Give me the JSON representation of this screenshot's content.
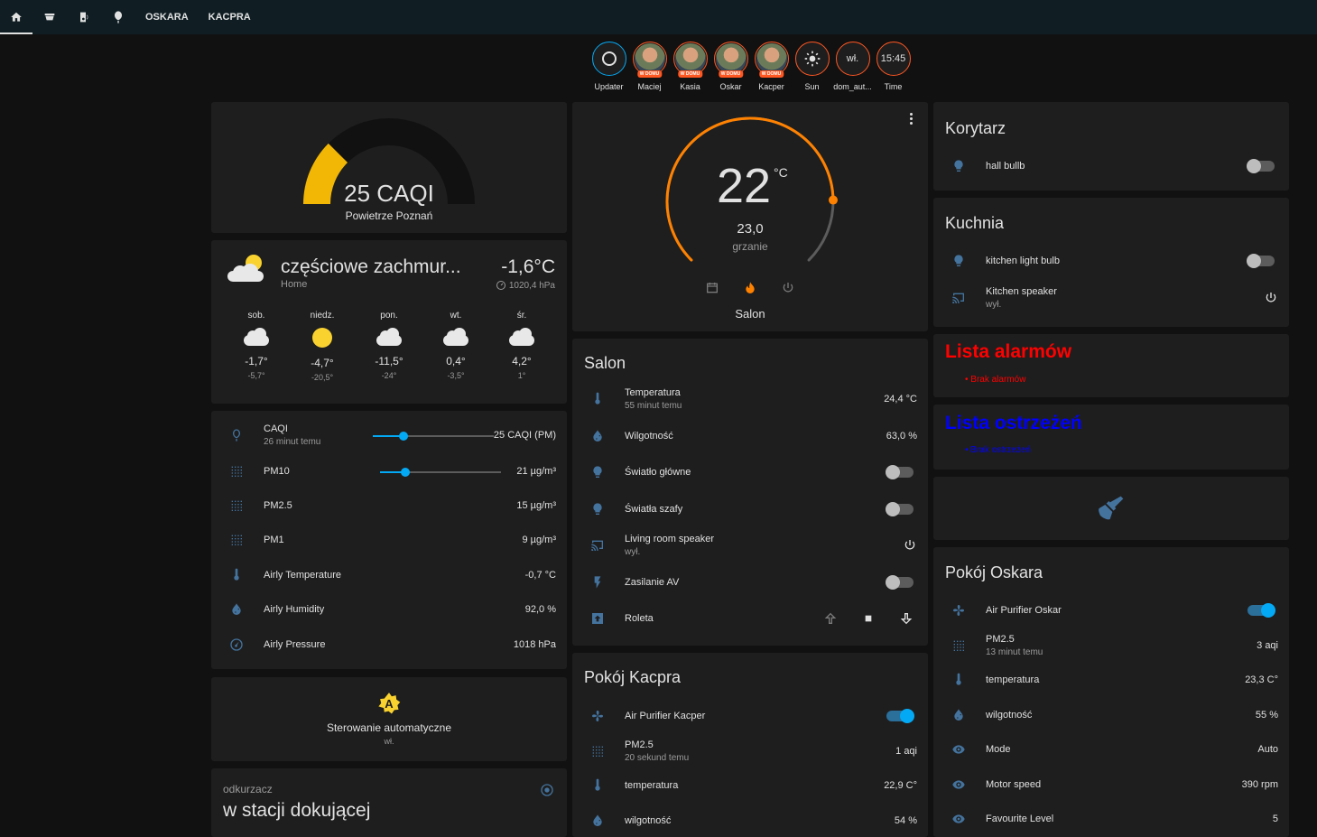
{
  "nav": {
    "tabs": [
      "OSKARA",
      "KACPRA"
    ]
  },
  "badges": [
    {
      "label": "Updater",
      "text": "",
      "type": "updater"
    },
    {
      "label": "Maciej",
      "tag": "W DOMU",
      "type": "person"
    },
    {
      "label": "Kasia",
      "tag": "W DOMU",
      "type": "person"
    },
    {
      "label": "Oskar",
      "tag": "W DOMU",
      "type": "person"
    },
    {
      "label": "Kacper",
      "tag": "W DOMU",
      "type": "person"
    },
    {
      "label": "Sun",
      "text": "",
      "type": "sun"
    },
    {
      "label": "dom_aut...",
      "text": "wł.",
      "type": "text"
    },
    {
      "label": "Time",
      "text": "15:45",
      "type": "text"
    }
  ],
  "gauge": {
    "value_text": "25 CAQI",
    "name": "Powietrze Poznań",
    "value": 25,
    "min": 0,
    "max": 100,
    "color": "#f2b705"
  },
  "weather": {
    "condition": "częściowe zachmur...",
    "location": "Home",
    "temp": "-1,6°C",
    "pressure": "1020,4 hPa",
    "forecast": [
      {
        "day": "sob.",
        "hi": "-1,7°",
        "lo": "-5,7°",
        "icon": "cloud"
      },
      {
        "day": "niedz.",
        "hi": "-4,7°",
        "lo": "-20,5°",
        "icon": "sun"
      },
      {
        "day": "pon.",
        "hi": "-11,5°",
        "lo": "-24°",
        "icon": "cloud"
      },
      {
        "day": "wt.",
        "hi": "0,4°",
        "lo": "-3,5°",
        "icon": "cloud"
      },
      {
        "day": "śr.",
        "hi": "4,2°",
        "lo": "1°",
        "icon": "cloud"
      }
    ]
  },
  "airly": {
    "rows": [
      {
        "name": "CAQI",
        "secondary": "26 minut temu",
        "value": "25 CAQI (PM)",
        "icon": "balloon-icon",
        "slider": 0.25
      },
      {
        "name": "PM10",
        "secondary": "",
        "value": "21 µg/m³",
        "icon": "dots-icon",
        "slider": 0.21
      },
      {
        "name": "PM2.5",
        "secondary": "",
        "value": "15 µg/m³",
        "icon": "dots-icon"
      },
      {
        "name": "PM1",
        "secondary": "",
        "value": "9 µg/m³",
        "icon": "dots-icon"
      },
      {
        "name": "Airly Temperature",
        "secondary": "",
        "value": "-0,7 °C",
        "icon": "thermometer-icon"
      },
      {
        "name": "Airly Humidity",
        "secondary": "",
        "value": "92,0 %",
        "icon": "water-percent-icon"
      },
      {
        "name": "Airly Pressure",
        "secondary": "",
        "value": "1018 hPa",
        "icon": "gauge-icon"
      }
    ]
  },
  "automation": {
    "name": "Sterowanie automatyczne",
    "state": "wł.",
    "badge": "A"
  },
  "vacuum": {
    "name": "odkurzacz",
    "state": "w stacji dokującej"
  },
  "thermostat": {
    "target": "22",
    "unit": "°C",
    "current": "23,0",
    "action": "grzanie",
    "name": "Salon",
    "target_fraction": 0.83,
    "current_fraction": 0.9
  },
  "salon": {
    "title": "Salon",
    "rows": [
      {
        "name": "Temperatura",
        "secondary": "55 minut temu",
        "value": "24,4 °C",
        "icon": "thermometer-icon",
        "kind": "value"
      },
      {
        "name": "Wilgotność",
        "secondary": "",
        "value": "63,0 %",
        "icon": "water-percent-icon",
        "kind": "value"
      },
      {
        "name": "Światło główne",
        "secondary": "",
        "value": "",
        "icon": "lightbulb-icon",
        "kind": "toggle",
        "on": false
      },
      {
        "name": "Światła szafy",
        "secondary": "",
        "value": "",
        "icon": "lightbulb-icon",
        "kind": "toggle",
        "on": false
      },
      {
        "name": "Living room speaker",
        "secondary": "wył.",
        "value": "",
        "icon": "cast-icon",
        "kind": "power"
      },
      {
        "name": "Zasilanie AV",
        "secondary": "",
        "value": "",
        "icon": "flash-icon",
        "kind": "toggle",
        "on": false
      },
      {
        "name": "Roleta",
        "secondary": "",
        "value": "",
        "icon": "blind-icon",
        "kind": "cover"
      }
    ]
  },
  "kacper": {
    "title": "Pokój Kacpra",
    "rows": [
      {
        "name": "Air Purifier Kacper",
        "secondary": "",
        "value": "",
        "icon": "fan-icon",
        "kind": "toggle",
        "on": true
      },
      {
        "name": "PM2.5",
        "secondary": "20 sekund temu",
        "value": "1 aqi",
        "icon": "dots-icon",
        "kind": "value"
      },
      {
        "name": "temperatura",
        "secondary": "",
        "value": "22,9 C°",
        "icon": "thermometer-icon",
        "kind": "value"
      },
      {
        "name": "wilgotność",
        "secondary": "",
        "value": "54 %",
        "icon": "water-percent-icon",
        "kind": "value"
      }
    ]
  },
  "korytarz": {
    "title": "Korytarz",
    "rows": [
      {
        "name": "hall bullb",
        "icon": "lightbulb-icon",
        "kind": "toggle",
        "on": false
      }
    ]
  },
  "kuchnia": {
    "title": "Kuchnia",
    "rows": [
      {
        "name": "kitchen light bulb",
        "secondary": "",
        "icon": "lightbulb-icon",
        "kind": "toggle",
        "on": false
      },
      {
        "name": "Kitchen speaker",
        "secondary": "wył.",
        "icon": "cast-icon",
        "kind": "power"
      }
    ]
  },
  "alarms": {
    "title": "Lista alarmów",
    "item": "Brak alarmów",
    "color": "#ff0000"
  },
  "warnings": {
    "title": "Lista ostrzeżeń",
    "item": "Brak ostrzeżeń",
    "color": "#0000ff"
  },
  "oskar": {
    "title": "Pokój Oskara",
    "rows": [
      {
        "name": "Air Purifier Oskar",
        "secondary": "",
        "value": "",
        "icon": "fan-icon",
        "kind": "toggle",
        "on": true
      },
      {
        "name": "PM2.5",
        "secondary": "13 minut temu",
        "value": "3 aqi",
        "icon": "dots-icon",
        "kind": "value"
      },
      {
        "name": "temperatura",
        "secondary": "",
        "value": "23,3 C°",
        "icon": "thermometer-icon",
        "kind": "value"
      },
      {
        "name": "wilgotność",
        "secondary": "",
        "value": "55 %",
        "icon": "water-percent-icon",
        "kind": "value"
      },
      {
        "name": "Mode",
        "secondary": "",
        "value": "Auto",
        "icon": "eye-icon",
        "kind": "value"
      },
      {
        "name": "Motor speed",
        "secondary": "",
        "value": "390 rpm",
        "icon": "eye-icon",
        "kind": "value"
      },
      {
        "name": "Favourite Level",
        "secondary": "",
        "value": "5",
        "icon": "eye-icon",
        "kind": "value"
      }
    ]
  }
}
